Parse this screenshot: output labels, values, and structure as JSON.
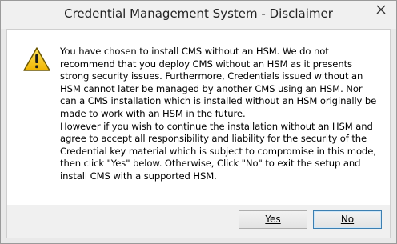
{
  "window": {
    "title": "Credential Management System - Disclaimer"
  },
  "icons": {
    "close": "close-icon",
    "warning": "warning-icon"
  },
  "message": {
    "paragraph1": "You have chosen to install CMS without an HSM.  We do not recommend that you deploy CMS without an HSM as it presents strong security issues. Furthermore, Credentials issued without an HSM cannot later be managed by another CMS using an HSM. Nor can a CMS installation which is installed without an HSM originally be made to work with an HSM in the future.",
    "paragraph2": "However if you wish to continue the installation without an HSM and agree to accept all responsibility and liability for the security of the Credential key material which is subject to compromise in this mode, then click \"Yes\" below. Otherwise, Click \"No\" to exit the setup and install CMS with a supported HSM."
  },
  "buttons": {
    "yes_label": "Yes",
    "no_label": "No"
  },
  "colors": {
    "warning_fill": "#f5c400",
    "warning_border": "#5a4a00",
    "focus_border": "#3c7fb1"
  }
}
